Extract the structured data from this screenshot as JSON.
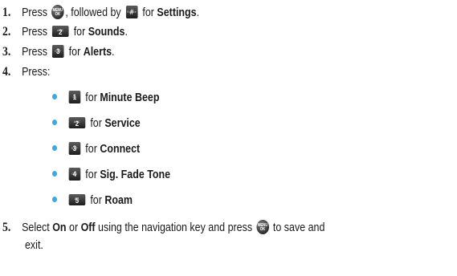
{
  "steps": [
    {
      "num": "1.",
      "pre": "Press",
      "mid": ", followed by",
      "post": "for",
      "bold": "Settings",
      "end": ".",
      "key": {
        "number": "#",
        "letters": "Space"
      }
    },
    {
      "num": "2.",
      "pre": "Press",
      "post": "for",
      "bold": "Sounds",
      "end": ".",
      "key": {
        "number": "2",
        "letters": "ABC"
      }
    },
    {
      "num": "3.",
      "pre": "Press",
      "post": "for",
      "bold": "Alerts",
      "end": ".",
      "key": {
        "number": "3",
        "letters": "DEF"
      }
    },
    {
      "num": "4.",
      "text": "Press:"
    },
    {
      "num": "5.",
      "pre": "Select",
      "bold1": "On",
      "or": "or",
      "bold2": "Off",
      "mid": "using the navigation key and press",
      "post": "to save and",
      "line2": "exit."
    }
  ],
  "ok_key": {
    "line1": "MENU",
    "line2": "OK"
  },
  "sub_items": [
    {
      "for": "for",
      "label": "Minute Beep",
      "key": {
        "number": "1",
        "letters": "oo"
      }
    },
    {
      "for": "for",
      "label": "Service",
      "key": {
        "number": "2",
        "letters": "ABC"
      }
    },
    {
      "for": "for",
      "label": "Connect",
      "key": {
        "number": "3",
        "letters": "DEF"
      }
    },
    {
      "for": "for",
      "label": "Sig. Fade Tone",
      "key": {
        "number": "4",
        "letters": "GHI"
      }
    },
    {
      "for": "for",
      "label": "Roam",
      "key": {
        "number": "5",
        "letters": "JKL"
      }
    }
  ]
}
